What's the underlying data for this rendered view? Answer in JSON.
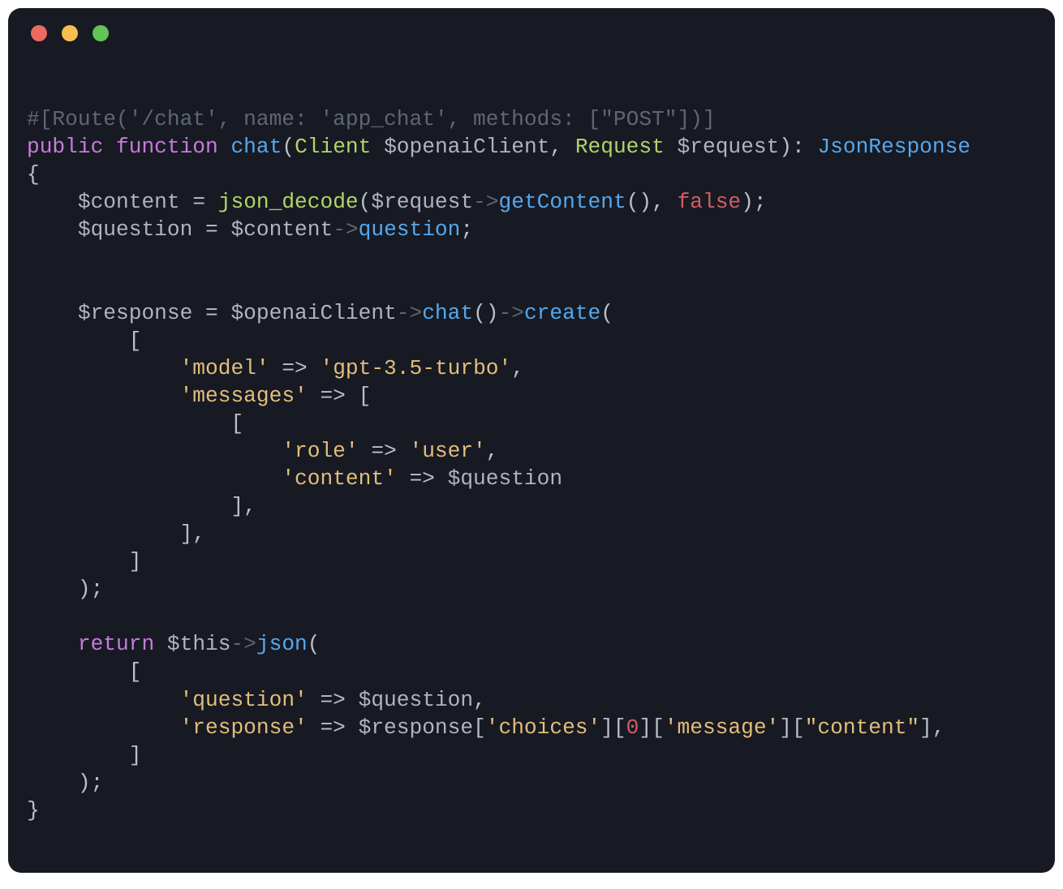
{
  "window": {
    "traffic_lights": {
      "close_color": "#ec6a5e",
      "min_color": "#f4bf4f",
      "max_color": "#61c454"
    }
  },
  "code": {
    "tokens": [
      [
        {
          "t": "#[Route('/chat', name: 'app_chat', methods: [\"POST\"])]",
          "c": "c-comment"
        }
      ],
      [
        {
          "t": "public",
          "c": "c-keyword"
        },
        {
          "t": " ",
          "c": "c-punct"
        },
        {
          "t": "function",
          "c": "c-keyword"
        },
        {
          "t": " ",
          "c": "c-punct"
        },
        {
          "t": "chat",
          "c": "c-func"
        },
        {
          "t": "(",
          "c": "c-punct"
        },
        {
          "t": "Client",
          "c": "c-type"
        },
        {
          "t": " ",
          "c": "c-punct"
        },
        {
          "t": "$openaiClient",
          "c": "c-var"
        },
        {
          "t": ", ",
          "c": "c-punct"
        },
        {
          "t": "Request",
          "c": "c-type"
        },
        {
          "t": " ",
          "c": "c-punct"
        },
        {
          "t": "$request",
          "c": "c-var"
        },
        {
          "t": "): ",
          "c": "c-punct"
        },
        {
          "t": "JsonResponse",
          "c": "c-func"
        }
      ],
      [
        {
          "t": "{",
          "c": "c-punct"
        }
      ],
      [
        {
          "t": "    ",
          "c": "c-punct"
        },
        {
          "t": "$content",
          "c": "c-var"
        },
        {
          "t": " = ",
          "c": "c-punct"
        },
        {
          "t": "json_decode",
          "c": "c-type"
        },
        {
          "t": "(",
          "c": "c-punct"
        },
        {
          "t": "$request",
          "c": "c-var"
        },
        {
          "t": "->",
          "c": "c-arrow"
        },
        {
          "t": "getContent",
          "c": "c-func"
        },
        {
          "t": "(), ",
          "c": "c-punct"
        },
        {
          "t": "false",
          "c": "c-bool"
        },
        {
          "t": ");",
          "c": "c-punct"
        }
      ],
      [
        {
          "t": "    ",
          "c": "c-punct"
        },
        {
          "t": "$question",
          "c": "c-var"
        },
        {
          "t": " = ",
          "c": "c-punct"
        },
        {
          "t": "$content",
          "c": "c-var"
        },
        {
          "t": "->",
          "c": "c-arrow"
        },
        {
          "t": "question",
          "c": "c-func"
        },
        {
          "t": ";",
          "c": "c-punct"
        }
      ],
      [
        {
          "t": "",
          "c": "c-punct"
        }
      ],
      [
        {
          "t": "",
          "c": "c-punct"
        }
      ],
      [
        {
          "t": "    ",
          "c": "c-punct"
        },
        {
          "t": "$response",
          "c": "c-var"
        },
        {
          "t": " = ",
          "c": "c-punct"
        },
        {
          "t": "$openaiClient",
          "c": "c-var"
        },
        {
          "t": "->",
          "c": "c-arrow"
        },
        {
          "t": "chat",
          "c": "c-func"
        },
        {
          "t": "()",
          "c": "c-punct"
        },
        {
          "t": "->",
          "c": "c-arrow"
        },
        {
          "t": "create",
          "c": "c-func"
        },
        {
          "t": "(",
          "c": "c-punct"
        }
      ],
      [
        {
          "t": "        [",
          "c": "c-punct"
        }
      ],
      [
        {
          "t": "            ",
          "c": "c-punct"
        },
        {
          "t": "'model'",
          "c": "c-string"
        },
        {
          "t": " ",
          "c": "c-punct"
        },
        {
          "t": "=>",
          "c": "c-fatarrow"
        },
        {
          "t": " ",
          "c": "c-punct"
        },
        {
          "t": "'gpt-3.5-turbo'",
          "c": "c-string"
        },
        {
          "t": ",",
          "c": "c-punct"
        }
      ],
      [
        {
          "t": "            ",
          "c": "c-punct"
        },
        {
          "t": "'messages'",
          "c": "c-string"
        },
        {
          "t": " ",
          "c": "c-punct"
        },
        {
          "t": "=>",
          "c": "c-fatarrow"
        },
        {
          "t": " [",
          "c": "c-punct"
        }
      ],
      [
        {
          "t": "                [",
          "c": "c-punct"
        }
      ],
      [
        {
          "t": "                    ",
          "c": "c-punct"
        },
        {
          "t": "'role'",
          "c": "c-string"
        },
        {
          "t": " ",
          "c": "c-punct"
        },
        {
          "t": "=>",
          "c": "c-fatarrow"
        },
        {
          "t": " ",
          "c": "c-punct"
        },
        {
          "t": "'user'",
          "c": "c-string"
        },
        {
          "t": ",",
          "c": "c-punct"
        }
      ],
      [
        {
          "t": "                    ",
          "c": "c-punct"
        },
        {
          "t": "'content'",
          "c": "c-string"
        },
        {
          "t": " ",
          "c": "c-punct"
        },
        {
          "t": "=>",
          "c": "c-fatarrow"
        },
        {
          "t": " ",
          "c": "c-punct"
        },
        {
          "t": "$question",
          "c": "c-var"
        }
      ],
      [
        {
          "t": "                ],",
          "c": "c-punct"
        }
      ],
      [
        {
          "t": "            ],",
          "c": "c-punct"
        }
      ],
      [
        {
          "t": "        ]",
          "c": "c-punct"
        }
      ],
      [
        {
          "t": "    );",
          "c": "c-punct"
        }
      ],
      [
        {
          "t": "",
          "c": "c-punct"
        }
      ],
      [
        {
          "t": "    ",
          "c": "c-punct"
        },
        {
          "t": "return",
          "c": "c-kw-return"
        },
        {
          "t": " ",
          "c": "c-punct"
        },
        {
          "t": "$this",
          "c": "c-var"
        },
        {
          "t": "->",
          "c": "c-arrow"
        },
        {
          "t": "json",
          "c": "c-func"
        },
        {
          "t": "(",
          "c": "c-punct"
        }
      ],
      [
        {
          "t": "        [",
          "c": "c-punct"
        }
      ],
      [
        {
          "t": "            ",
          "c": "c-punct"
        },
        {
          "t": "'question'",
          "c": "c-string"
        },
        {
          "t": " ",
          "c": "c-punct"
        },
        {
          "t": "=>",
          "c": "c-fatarrow"
        },
        {
          "t": " ",
          "c": "c-punct"
        },
        {
          "t": "$question",
          "c": "c-var"
        },
        {
          "t": ",",
          "c": "c-punct"
        }
      ],
      [
        {
          "t": "            ",
          "c": "c-punct"
        },
        {
          "t": "'response'",
          "c": "c-string"
        },
        {
          "t": " ",
          "c": "c-punct"
        },
        {
          "t": "=>",
          "c": "c-fatarrow"
        },
        {
          "t": " ",
          "c": "c-punct"
        },
        {
          "t": "$response",
          "c": "c-var"
        },
        {
          "t": "[",
          "c": "c-punct"
        },
        {
          "t": "'choices'",
          "c": "c-string"
        },
        {
          "t": "][",
          "c": "c-punct"
        },
        {
          "t": "0",
          "c": "c-num"
        },
        {
          "t": "][",
          "c": "c-punct"
        },
        {
          "t": "'message'",
          "c": "c-string"
        },
        {
          "t": "][",
          "c": "c-punct"
        },
        {
          "t": "\"content\"",
          "c": "c-string"
        },
        {
          "t": "],",
          "c": "c-punct"
        }
      ],
      [
        {
          "t": "        ]",
          "c": "c-punct"
        }
      ],
      [
        {
          "t": "    );",
          "c": "c-punct"
        }
      ],
      [
        {
          "t": "}",
          "c": "c-punct"
        }
      ]
    ]
  }
}
